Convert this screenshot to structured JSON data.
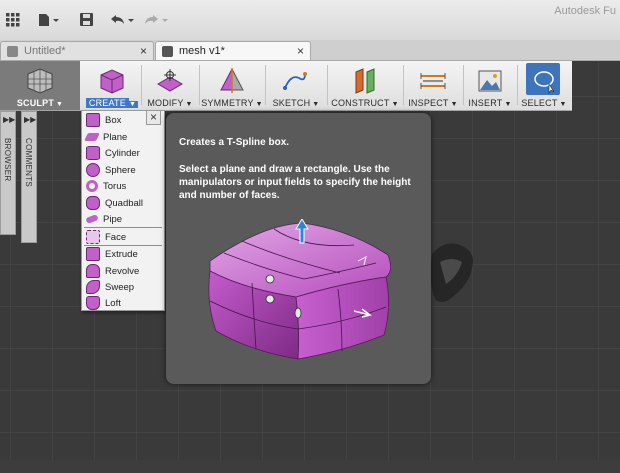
{
  "app": {
    "title": "Autodesk Fu"
  },
  "tabs": [
    {
      "label": "Untitled*",
      "active": false
    },
    {
      "label": "mesh v1*",
      "active": true
    }
  ],
  "toolbar": {
    "sculpt": "SCULPT",
    "create": "CREATE",
    "modify": "MODIFY",
    "symmetry": "SYMMETRY",
    "sketch": "SKETCH",
    "construct": "CONSTRUCT",
    "inspect": "INSPECT",
    "insert": "INSERT",
    "select": "SELECT"
  },
  "panels": {
    "browser": "BROWSER",
    "comments": "COMMENTS"
  },
  "create_menu": {
    "items": [
      "Box",
      "Plane",
      "Cylinder",
      "Sphere",
      "Torus",
      "Quadball",
      "Pipe",
      "Face",
      "Extrude",
      "Revolve",
      "Sweep",
      "Loft"
    ],
    "close_symbol": "×"
  },
  "tooltip": {
    "title": "Creates a T-Spline box.",
    "body": "Select a plane and draw a rectangle. Use the manipulators or input fields to specify the height and number of faces."
  },
  "colors": {
    "accent": "#3f78c9",
    "tspline_purple": "#b050b8",
    "tooltip_bg": "#5a5a5a",
    "canvas_bg": "#3a3a3a"
  }
}
